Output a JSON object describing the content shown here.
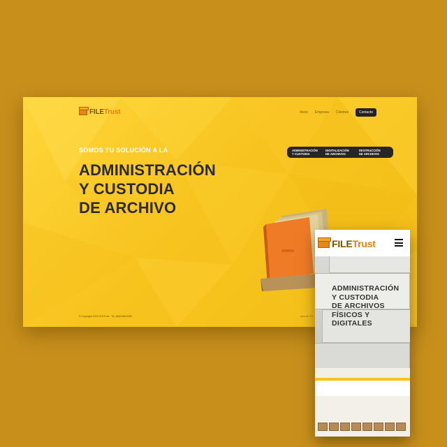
{
  "brand": {
    "file": "FILE",
    "trust": "Trust"
  },
  "colors": {
    "background": "#c8901b",
    "accent": "#f6c21c",
    "orange": "#e8861a",
    "dark": "#262626"
  },
  "desktop": {
    "nav": [
      "Inicio",
      "Empresa",
      "Clientes",
      "Contacto"
    ],
    "kicker": "SOMOS TU SOLUCIÓN A LA",
    "headline": [
      "ADMINISTRACIÓN",
      "Y CUSTODIA",
      "DE ARCHIVO"
    ],
    "pills": [
      {
        "line1": "ADMINISTRACIÓN",
        "line2": "Y CUSTODIA"
      },
      {
        "line1": "DIGITALIZACIÓN",
        "line2": "DE ARCHIVOS"
      },
      {
        "line1": "DESTRUCCIÓN",
        "line2": "DE ARCHIVOS"
      }
    ],
    "copyright": "© Copyright 2019 FILETrust · Tel. (56)2468 5955",
    "footer_right": "Area de Pri"
  },
  "mobile": {
    "menu_icon": "hamburger-icon",
    "headline": [
      "ADMINISTRACIÓN",
      "Y CUSTODIA",
      "DE ARCHIVOS",
      "FÍSICOS Y",
      "DIGITALES"
    ]
  }
}
